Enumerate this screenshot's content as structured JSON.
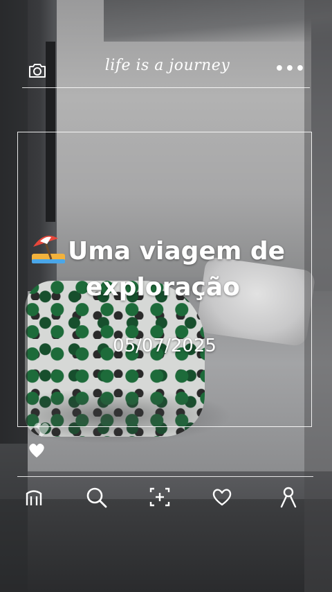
{
  "header": {
    "title": "life is a journey",
    "left_icon": "camera-icon",
    "right_icon": "more-dots-icon",
    "more_label": "•••"
  },
  "post": {
    "headline_emoji": "beach-umbrella-emoji",
    "headline": "Uma viagem de",
    "headline_line2": "exploração",
    "date": "05/07/2025"
  },
  "floating_icons": [
    "heart-icon",
    "heart-icon"
  ],
  "nav": {
    "items": [
      {
        "icon": "home-icon"
      },
      {
        "icon": "search-icon"
      },
      {
        "icon": "add-post-icon"
      },
      {
        "icon": "heart-icon"
      },
      {
        "icon": "profile-icon"
      }
    ]
  },
  "colors": {
    "foreground": "#ffffff",
    "background": "#7d7e80"
  }
}
